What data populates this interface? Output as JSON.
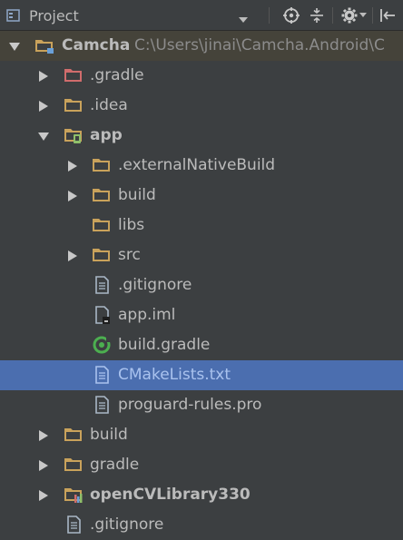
{
  "toolbar": {
    "title": "Project",
    "icons": [
      "project-view-icon",
      "chevron-down-icon",
      "locate-target-icon",
      "collapse-all-icon",
      "gear-icon",
      "gear-dropdown-icon",
      "hide-panel-icon"
    ]
  },
  "tree": {
    "root": {
      "label": "Camcha",
      "path": "C:\\Users\\jinai\\Camcha.Android\\C"
    },
    "items": [
      {
        "label": ".gradle"
      },
      {
        "label": ".idea"
      },
      {
        "label": "app"
      },
      {
        "label": ".externalNativeBuild"
      },
      {
        "label": "build"
      },
      {
        "label": "libs"
      },
      {
        "label": "src"
      },
      {
        "label": ".gitignore"
      },
      {
        "label": "app.iml"
      },
      {
        "label": "build.gradle"
      },
      {
        "label": "CMakeLists.txt"
      },
      {
        "label": "proguard-rules.pro"
      },
      {
        "label": "build"
      },
      {
        "label": "gradle"
      },
      {
        "label": "openCVLibrary330"
      },
      {
        "label": ".gitignore"
      }
    ]
  },
  "colors": {
    "background": "#3c3f41",
    "selection": "#4b6eaf",
    "folder": "#c9a25b",
    "excluded_folder": "#d06c6c",
    "text": "#bbbbbb",
    "path_text": "#8c8c8c"
  }
}
